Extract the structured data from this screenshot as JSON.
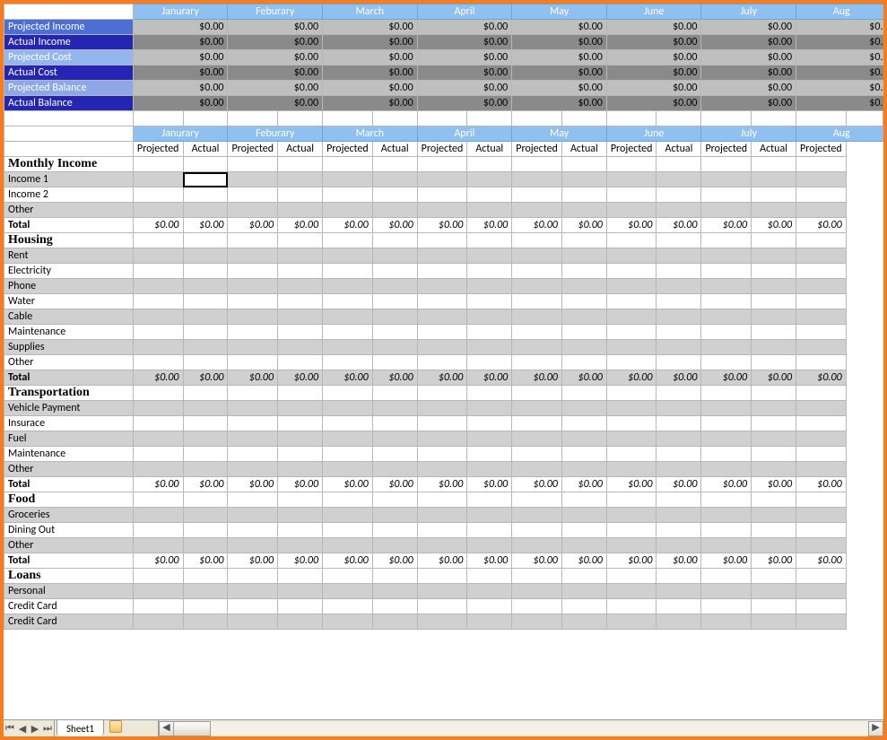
{
  "months": [
    "Janurary",
    "Feburary",
    "March",
    "April",
    "May",
    "June",
    "July",
    "Aug"
  ],
  "summary_rows": [
    {
      "label": "Projected Income",
      "cls": "pi",
      "valcls": "summary-val",
      "cells": [
        "$0.00",
        "$0.00",
        "$0.00",
        "$0.00",
        "$0.00",
        "$0.00",
        "$0.00",
        "$0."
      ]
    },
    {
      "label": "Actual Income",
      "cls": "ai",
      "valcls": "summary-val-dk",
      "cells": [
        "$0.00",
        "$0.00",
        "$0.00",
        "$0.00",
        "$0.00",
        "$0.00",
        "$0.00",
        "$0."
      ]
    },
    {
      "label": "Projected Cost",
      "cls": "pc",
      "valcls": "summary-val",
      "cells": [
        "$0.00",
        "$0.00",
        "$0.00",
        "$0.00",
        "$0.00",
        "$0.00",
        "$0.00",
        "$0."
      ]
    },
    {
      "label": "Actual Cost",
      "cls": "ac",
      "valcls": "summary-val-dk",
      "cells": [
        "$0.00",
        "$0.00",
        "$0.00",
        "$0.00",
        "$0.00",
        "$0.00",
        "$0.00",
        "$0."
      ]
    },
    {
      "label": "Projected Balance",
      "cls": "pb",
      "valcls": "summary-val",
      "cells": [
        "$0.00",
        "$0.00",
        "$0.00",
        "$0.00",
        "$0.00",
        "$0.00",
        "$0.00",
        "$0."
      ]
    },
    {
      "label": "Actual Balance",
      "cls": "ab",
      "valcls": "summary-val-dk",
      "cells": [
        "$0.00",
        "$0.00",
        "$0.00",
        "$0.00",
        "$0.00",
        "$0.00",
        "$0.00",
        "$0."
      ]
    }
  ],
  "sub_months": [
    "Janurary",
    "Feburary",
    "March",
    "April",
    "May",
    "June",
    "July",
    "Aug"
  ],
  "sub_cols": {
    "projected": "Projected",
    "actual": "Actual"
  },
  "categories": [
    {
      "name": "Monthly Income",
      "items": [
        "Income 1",
        "Income 2",
        "Other"
      ],
      "selected_row": 0,
      "selected_col": 1
    },
    {
      "name": "Housing",
      "items": [
        "Rent",
        "Electricity",
        "Phone",
        "Water",
        "Cable",
        "Maintenance",
        "Supplies",
        "Other"
      ]
    },
    {
      "name": "Transportation",
      "items": [
        "Vehicle Payment",
        "Insurace",
        "Fuel",
        "Maintenance",
        "Other"
      ]
    },
    {
      "name": "Food",
      "items": [
        "Groceries",
        "Dining Out",
        "Other"
      ]
    },
    {
      "name": "Loans",
      "items": [
        "Personal",
        "Credit Card",
        "Credit Card"
      ]
    }
  ],
  "total_label": "Total",
  "total_value": "$0.00",
  "sheet_tab": "Sheet1",
  "nav": {
    "first": "⏮",
    "prev": "◀",
    "next": "▶",
    "last": "⏭",
    "left": "◀",
    "right": "▶"
  }
}
